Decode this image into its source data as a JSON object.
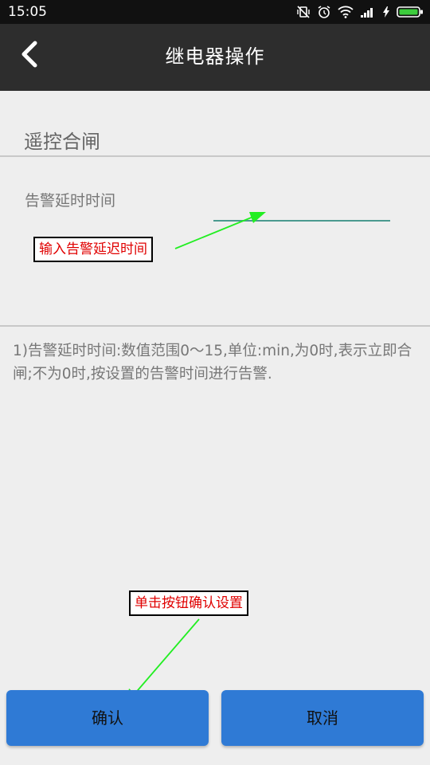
{
  "status_bar": {
    "time": "15:05"
  },
  "header": {
    "title": "继电器操作"
  },
  "section": {
    "title": "遥控合闸"
  },
  "form": {
    "delay_label": "告警延时时间",
    "delay_value": "",
    "delay_placeholder": ""
  },
  "note": {
    "text": "1)告警延时时间:数值范围0～15,单位:min,为0时,表示立即合闸;不为0时,按设置的告警时间进行告警."
  },
  "annotations": {
    "input_hint": "输入告警延迟时间",
    "button_hint": "单击按钮确认设置",
    "color": "#e00000",
    "arrow_color": "#22ee22"
  },
  "buttons": {
    "confirm": "确认",
    "cancel": "取消"
  },
  "colors": {
    "accent": "#2f7ad5",
    "app_bar": "#2d2d2d",
    "status_bar": "#111111",
    "input_underline": "#4a9a8f"
  }
}
